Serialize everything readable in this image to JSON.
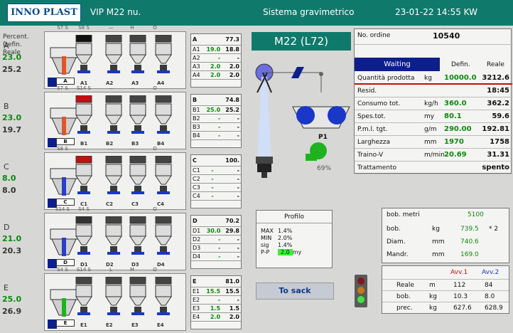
{
  "header": {
    "logo": "INNO PLAST",
    "machine": "VIP M22 nu.",
    "title": "Sistema gravimetrico",
    "datetime": "23-01-22 14:55  KW"
  },
  "left_header": {
    "percent": "Percent.",
    "defin": "Defin.",
    "reale": "Reale"
  },
  "rows": [
    {
      "id": "A",
      "defin": "23.0",
      "reale": "25.2",
      "badge": "A",
      "hoppers": [
        "S7 S",
        "S8 S",
        "—",
        "H",
        "O"
      ],
      "slabels": [
        "A1",
        "A2",
        "A3",
        "A4"
      ],
      "table": {
        "head": "A",
        "head_val": "77.3",
        "rows": [
          [
            "A1",
            "19.0",
            "18.8"
          ],
          [
            "A2",
            "-",
            "-"
          ],
          [
            "A3",
            "2.0",
            "2.0"
          ],
          [
            "A4",
            "2.0",
            "2.0"
          ]
        ]
      }
    },
    {
      "id": "B",
      "defin": "23.0",
      "reale": "19.7",
      "badge": "B",
      "hoppers": [
        "S7 S",
        "S14 S",
        "—",
        "—",
        "O"
      ],
      "slabels": [
        "B1",
        "B2",
        "B3",
        "B4"
      ],
      "table": {
        "head": "B",
        "head_val": "74.8",
        "rows": [
          [
            "B1",
            "25.0",
            "25.2"
          ],
          [
            "B2",
            "-",
            "-"
          ],
          [
            "B3",
            "-",
            "-"
          ],
          [
            "B4",
            "-",
            "-"
          ]
        ]
      }
    },
    {
      "id": "C",
      "defin": "8.0",
      "reale": "8.0",
      "badge": "C",
      "hoppers": [
        "S8 S",
        "—",
        "—",
        "—",
        "O"
      ],
      "slabels": [
        "C1",
        "C2",
        "C3",
        "C4"
      ],
      "table": {
        "head": "C",
        "head_val": "100.",
        "rows": [
          [
            "C1",
            "-",
            "-"
          ],
          [
            "C2",
            "-",
            "-"
          ],
          [
            "C3",
            "-",
            "-"
          ],
          [
            "C4",
            "-",
            "-"
          ]
        ]
      }
    },
    {
      "id": "D",
      "defin": "21.0",
      "reale": "20.3",
      "badge": "D",
      "hoppers": [
        "S14 S",
        "S4 S",
        "—",
        "—",
        "O"
      ],
      "slabels": [
        "D1",
        "D2",
        "D3",
        "D4"
      ],
      "table": {
        "head": "D",
        "head_val": "70.2",
        "rows": [
          [
            "D1",
            "30.0",
            "29.8"
          ],
          [
            "D2",
            "-",
            "-"
          ],
          [
            "D3",
            "-",
            "-"
          ],
          [
            "D4",
            "-",
            "-"
          ]
        ]
      }
    },
    {
      "id": "E",
      "defin": "25.0",
      "reale": "26.9",
      "badge": "E",
      "hoppers": [
        "S4 S",
        "S14 S",
        "L",
        "M",
        "O"
      ],
      "slabels": [
        "E1",
        "E2",
        "E3",
        "E4"
      ],
      "table": {
        "head": "E",
        "head_val": "81.0",
        "rows": [
          [
            "E1",
            "15.5",
            "15.5"
          ],
          [
            "E2",
            "-",
            "-"
          ],
          [
            "E3",
            "1.5",
            "1.5"
          ],
          [
            "E4",
            "2.0",
            "2.0"
          ]
        ]
      }
    }
  ],
  "machine_title": "M22 (L72)",
  "pump": {
    "label": "P1",
    "percent": "69%"
  },
  "right_table": {
    "order_label": "No. ordine",
    "order_value": "10540",
    "status": "Waiting",
    "col_defin": "Defin.",
    "col_reale": "Reale",
    "rows": [
      {
        "label": "Quantità prodotta",
        "unit": "kg",
        "defin": "10000.0",
        "reale": "3212.6"
      },
      {
        "label": "Resid.",
        "unit": "",
        "defin": "",
        "reale": "18:45"
      },
      {
        "label": "Consumo tot.",
        "unit": "kg/h",
        "defin": "360.0",
        "reale": "362.2"
      },
      {
        "label": "Spes.tot.",
        "unit": "my",
        "defin": "80.1",
        "reale": "59.6"
      },
      {
        "label": "P.m.l. tgt.",
        "unit": "g/m",
        "defin": "290.00",
        "reale": "192.81"
      },
      {
        "label": "Larghezza",
        "unit": "mm",
        "defin": "1970",
        "reale": "1758"
      },
      {
        "label": "Traino-V",
        "unit": "m/min",
        "defin": "20.69",
        "reale": "31.31"
      },
      {
        "label": "Trattamento",
        "unit": "",
        "defin": "",
        "reale": "spento"
      }
    ]
  },
  "profilo": {
    "title": "Profilo",
    "max_label": "MAX",
    "max": "1.4%",
    "min_label": "MIN",
    "min": "2.0%",
    "sig_label": "sig",
    "sig": "1.4%",
    "pp_label": "P-P",
    "pp": "2.0",
    "pp_unit": "my"
  },
  "tosack": "To sack",
  "bob": {
    "metri_label": "bob. metri",
    "metri": "5100",
    "bob_label": "bob.",
    "bob_unit": "kg",
    "bob": "739.5",
    "bob_count": "* 2",
    "diam_label": "Diam.",
    "diam_unit": "mm",
    "diam": "740.6",
    "mandr_label": "Mandr.",
    "mandr_unit": "mm",
    "mandr": "169.0"
  },
  "avv": {
    "h1": "Avv.1",
    "h2": "Avv.2",
    "rows": [
      {
        "label": "Reale",
        "unit": "m",
        "v1": "112",
        "v2": "84"
      },
      {
        "label": "bob.",
        "unit": "kg",
        "v1": "10.3",
        "v2": "8.0"
      },
      {
        "label": "prec.",
        "unit": "kg",
        "v1": "627.6",
        "v2": "628.9"
      }
    ]
  },
  "colors": {
    "header": "#0f7a6c",
    "green": "#0a8a0a",
    "blue": "#0d1f8c"
  }
}
